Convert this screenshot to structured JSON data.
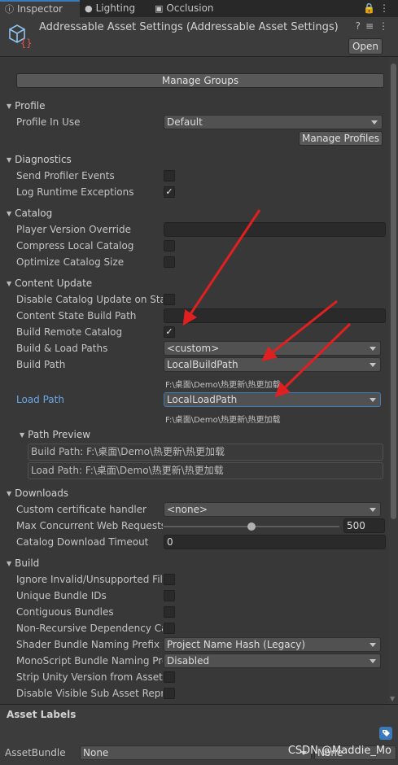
{
  "tabs": [
    {
      "label": "Inspector",
      "icon": "info-icon"
    },
    {
      "label": "Lighting",
      "icon": "bulb-icon"
    },
    {
      "label": "Occlusion",
      "icon": "box-icon"
    }
  ],
  "header": {
    "title": "Addressable Asset Settings (Addressable Asset Settings)",
    "open_label": "Open"
  },
  "manage_groups_label": "Manage Groups",
  "profile": {
    "title": "Profile",
    "profile_in_use_label": "Profile In Use",
    "profile_in_use_value": "Default",
    "manage_profiles_label": "Manage Profiles"
  },
  "diagnostics": {
    "title": "Diagnostics",
    "send_profiler_events_label": "Send Profiler Events",
    "send_profiler_events_checked": false,
    "log_runtime_exceptions_label": "Log Runtime Exceptions",
    "log_runtime_exceptions_checked": true
  },
  "catalog": {
    "title": "Catalog",
    "player_version_override_label": "Player Version Override",
    "player_version_override_value": "",
    "compress_local_catalog_label": "Compress Local Catalog",
    "optimize_catalog_size_label": "Optimize Catalog Size"
  },
  "content_update": {
    "title": "Content Update",
    "disable_catalog_update_label": "Disable Catalog Update on Startup",
    "content_state_build_path_label": "Content State Build Path",
    "content_state_build_path_value": "",
    "build_remote_catalog_label": "Build Remote Catalog",
    "build_remote_catalog_checked": true,
    "build_load_paths_label": "Build & Load Paths",
    "build_load_paths_value": "<custom>",
    "build_path_label": "Build Path",
    "build_path_value": "LocalBuildPath",
    "build_path_resolved": "F:\\桌面\\Demo\\热更新\\热更加载",
    "load_path_label": "Load Path",
    "load_path_value": "LocalLoadPath",
    "load_path_resolved": "F:\\桌面\\Demo\\热更新\\热更加载",
    "path_preview_title": "Path Preview",
    "preview_build_path": "Build Path: F:\\桌面\\Demo\\热更新\\热更加载",
    "preview_load_path": "Load Path: F:\\桌面\\Demo\\热更新\\热更加载"
  },
  "downloads": {
    "title": "Downloads",
    "custom_cert_label": "Custom certificate handler",
    "custom_cert_value": "<none>",
    "max_concurrent_label": "Max Concurrent Web Requests",
    "max_concurrent_value": "500",
    "max_concurrent_slider_fraction": 0.5,
    "catalog_timeout_label": "Catalog Download Timeout",
    "catalog_timeout_value": "0"
  },
  "build": {
    "title": "Build",
    "ignore_invalid_label": "Ignore Invalid/Unsupported Files in Build",
    "unique_bundle_ids_label": "Unique Bundle IDs",
    "contiguous_bundles_label": "Contiguous Bundles",
    "non_recursive_label": "Non-Recursive Dependency Calculation",
    "shader_naming_label": "Shader Bundle Naming Prefix",
    "shader_naming_value": "Project Name Hash (Legacy)",
    "monoscript_naming_label": "MonoScript Bundle Naming Prefix",
    "monoscript_naming_value": "Disabled",
    "strip_unity_version_label": "Strip Unity Version from AssetBundles",
    "disable_visible_sub_label": "Disable Visible Sub Asset Representations"
  },
  "bottom": {
    "asset_labels_title": "Asset Labels",
    "assetbundle_label": "AssetBundle",
    "assetbundle_value": "None",
    "variant_value": "None",
    "watermark": "CSDN @Maddie_Mo"
  },
  "colors": {
    "background": "#383838",
    "accent_blue": "#3a79bb",
    "arrow_red": "#e02020"
  }
}
